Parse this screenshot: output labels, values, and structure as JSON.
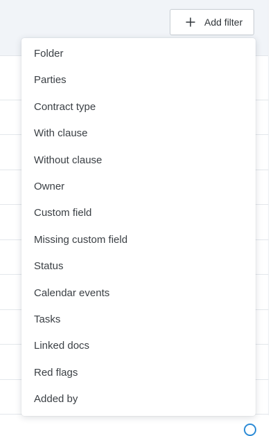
{
  "toolbar": {
    "add_filter_label": "Add filter",
    "add_filter_icon": "plus-icon"
  },
  "filter_menu": {
    "items": [
      {
        "label": "Folder"
      },
      {
        "label": "Parties"
      },
      {
        "label": "Contract type"
      },
      {
        "label": "With clause"
      },
      {
        "label": "Without clause"
      },
      {
        "label": "Owner"
      },
      {
        "label": "Custom field"
      },
      {
        "label": "Missing custom field"
      },
      {
        "label": "Status"
      },
      {
        "label": "Calendar events"
      },
      {
        "label": "Tasks"
      },
      {
        "label": "Linked docs"
      },
      {
        "label": "Red flags"
      },
      {
        "label": "Added by"
      }
    ]
  },
  "colors": {
    "accent": "#2c8bd6",
    "header_background": "#f1f4f8",
    "text": "#3a3f44"
  }
}
